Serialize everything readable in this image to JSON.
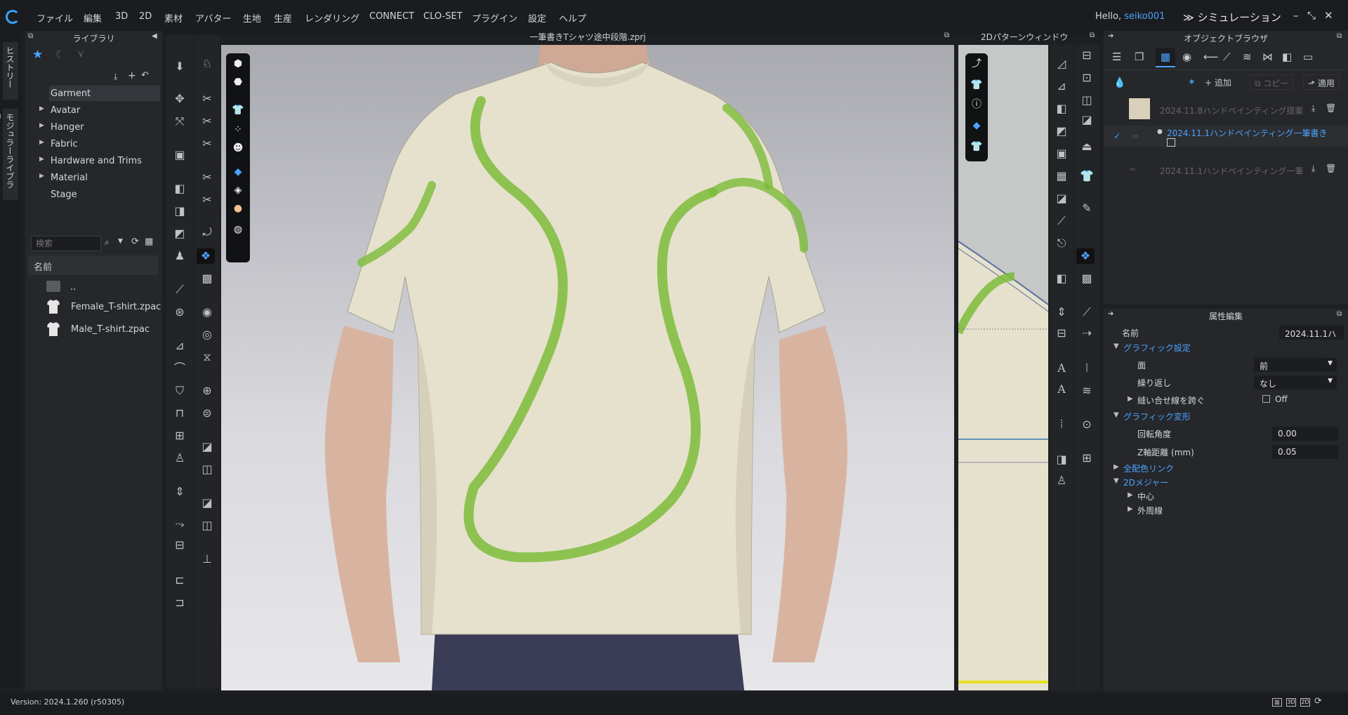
{
  "menubar": {
    "items": [
      "ファイル",
      "編集",
      "3D",
      "2D",
      "素材",
      "アバター",
      "生地",
      "生産",
      "レンダリング",
      "CONNECT",
      "CLO-SET",
      "プラグイン",
      "設定",
      "ヘルプ"
    ],
    "greeting": "Hello,",
    "user": "seiko001",
    "mode": "シミュレーション"
  },
  "left_tabs": [
    "ヒストリー",
    "モジュラーライブラリ"
  ],
  "library": {
    "title": "ライブラリ",
    "tree": [
      "Garment",
      "Avatar",
      "Hanger",
      "Fabric",
      "Hardware and Trims",
      "Material",
      "Stage"
    ],
    "search_placeholder": "検索",
    "column_header": "名前",
    "files": [
      "..",
      "Female_T-shirt.zpac",
      "Male_T-shirt.zpac"
    ]
  },
  "viewport": {
    "title": "一筆書きTシャツ途中段階.zprj"
  },
  "pattern_window": {
    "title": "2Dパターンウィンドウ"
  },
  "object_browser": {
    "title": "オブジェクトブラウザ",
    "add_label": "追加",
    "copy_label": "コピー",
    "apply_label": "適用",
    "items": [
      {
        "name": "2024.11.8ハンドペインティング提案",
        "active": false
      },
      {
        "name": "2024.11.1ハンドペインティング一筆書き",
        "active": true
      },
      {
        "name": "2024.11.1ハンドペインティング一筆",
        "active": false
      }
    ]
  },
  "properties": {
    "title": "属性編集",
    "name_label": "名前",
    "name_value": "2024.11.1ハ",
    "graphic_settings": "グラフィック設定",
    "face_label": "面",
    "face_value": "前",
    "repeat_label": "繰り返し",
    "repeat_value": "なし",
    "seam_label": "縫い合せ線を跨ぐ",
    "seam_value": "Off",
    "graphic_transform": "グラフィック変形",
    "rotation_label": "回転角度",
    "rotation_value": "0.00",
    "z_label": "Z軸距離 (mm)",
    "z_value": "0.05",
    "colorway": "全配色リンク",
    "measure": "2Dメジャー",
    "center": "中心",
    "outline": "外周線"
  },
  "status": {
    "version": "Version: 2024.1.260 (r50305)",
    "view_icons": [
      "3D",
      "2D"
    ]
  },
  "colors": {
    "accent": "#4aa3ff",
    "brush": "#7cbc3a",
    "fabric": "#e6e1cd"
  }
}
